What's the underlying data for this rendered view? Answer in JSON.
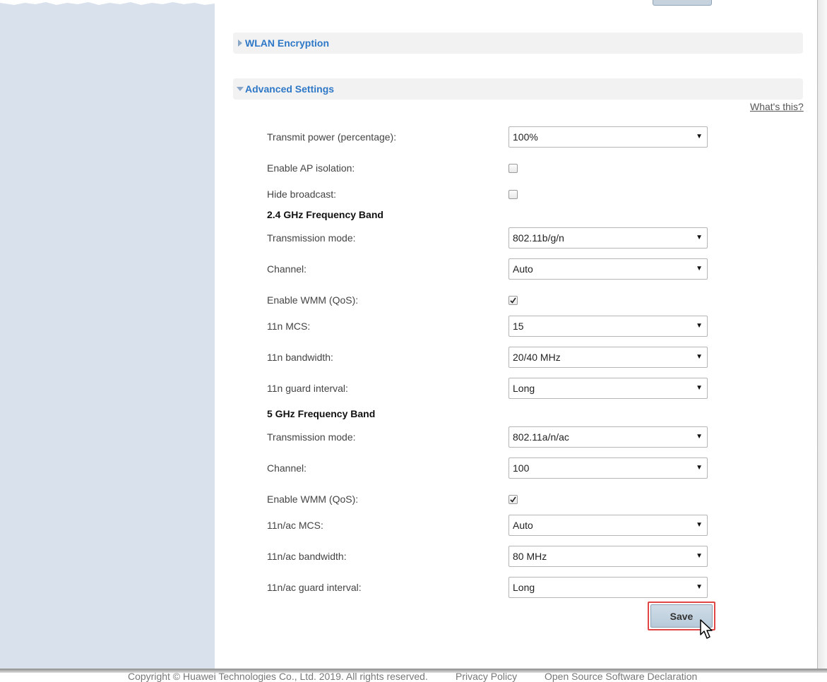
{
  "sections": {
    "wlan_encryption": {
      "label": "WLAN Encryption",
      "expanded": false
    },
    "advanced_settings": {
      "label": "Advanced Settings",
      "expanded": true
    }
  },
  "whats_this": "What's this?",
  "general": {
    "transmit_power": {
      "label": "Transmit power (percentage):",
      "value": "100%"
    },
    "ap_isolation": {
      "label": "Enable AP isolation:",
      "checked": false
    },
    "hide_broadcast": {
      "label": "Hide broadcast:",
      "checked": false
    }
  },
  "band_24": {
    "title": "2.4 GHz Frequency Band",
    "transmission_mode": {
      "label": "Transmission mode:",
      "value": "802.11b/g/n"
    },
    "channel": {
      "label": "Channel:",
      "value": "Auto"
    },
    "wmm": {
      "label": "Enable WMM (QoS):",
      "checked": true
    },
    "mcs": {
      "label": "11n MCS:",
      "value": "15"
    },
    "bandwidth": {
      "label": "11n bandwidth:",
      "value": "20/40 MHz"
    },
    "guard_interval": {
      "label": "11n guard interval:",
      "value": "Long"
    }
  },
  "band_5": {
    "title": "5 GHz Frequency Band",
    "transmission_mode": {
      "label": "Transmission mode:",
      "value": "802.11a/n/ac"
    },
    "channel": {
      "label": "Channel:",
      "value": "100"
    },
    "wmm": {
      "label": "Enable WMM (QoS):",
      "checked": true
    },
    "mcs": {
      "label": "11n/ac MCS:",
      "value": "Auto"
    },
    "bandwidth": {
      "label": "11n/ac bandwidth:",
      "value": "80 MHz"
    },
    "guard_interval": {
      "label": "11n/ac guard interval:",
      "value": "Long"
    }
  },
  "save_label": "Save",
  "footer": {
    "copyright": "Copyright © Huawei Technologies Co., Ltd. 2019. All rights reserved.",
    "privacy": "Privacy Policy",
    "open_source": "Open Source Software Declaration"
  },
  "colors": {
    "accent": "#2e78c7",
    "sidebar": "#d9e1ec",
    "highlight": "#e04646"
  },
  "icons": {
    "collapsed": "triangle-right-icon",
    "expanded": "triangle-down-icon",
    "select": "caret-down-icon",
    "checkbox": "check-icon",
    "pointer": "hand-pointer-icon"
  }
}
